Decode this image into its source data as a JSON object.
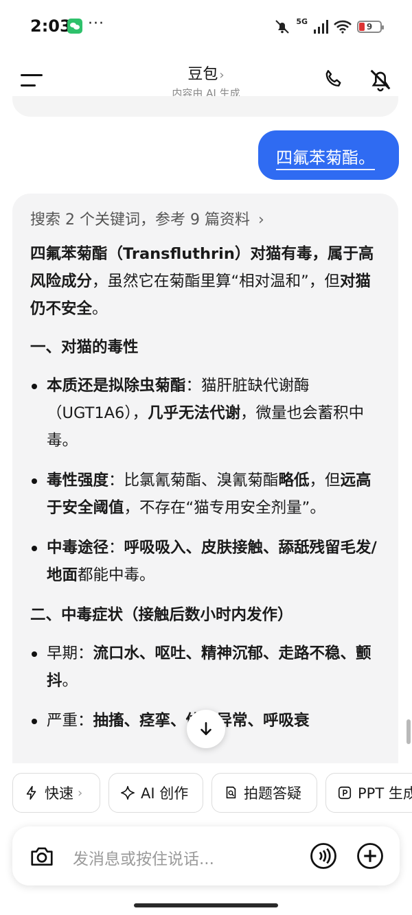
{
  "status_bar": {
    "time": "2:03",
    "more": "···",
    "network": "5G",
    "battery": "9"
  },
  "header": {
    "title": "豆包",
    "title_chevron": "›",
    "subtitle": "内容由 AI 生成"
  },
  "user_message": "四氟苯菊酯。",
  "ai_reply": {
    "reference_line": "搜索 2 个关键词，参考 9 篇资料",
    "reference_chevron": "›",
    "intro": {
      "p1_bold": "四氟苯菊酯（Transfluthrin）对猫有毒，属于高风险成分",
      "p1_text_a": "，虽然它在菊酯里算“相对温和”，但",
      "p1_bold_b": "对猫仍不安全",
      "p1_text_b": "。"
    },
    "section1": {
      "heading": "一、对猫的毒性",
      "items": [
        {
          "bold": "本质还是拟除虫菊酯",
          "text_a": "：猫肝脏缺代谢酶（UGT1A6），",
          "bold_b": "几乎无法代谢",
          "text_b": "，微量也会蓄积中毒。"
        },
        {
          "bold": "毒性强度",
          "text_a": "：比氯氰菊酯、溴氰菊酯",
          "bold_b": "略低",
          "text_b": "，但",
          "bold_c": "远高于安全阈值",
          "text_c": "，不存在“猫专用安全剂量”。"
        },
        {
          "bold": "中毒途径",
          "text_a": "：",
          "bold_b": "呼吸吸入、皮肤接触、舔舐残留毛发/地面",
          "text_b": "都能中毒。"
        }
      ]
    },
    "section2": {
      "heading": "二、中毒症状（接触后数小时内发作）",
      "items": [
        {
          "text_a": "早期：",
          "bold": "流口水、呕吐、精神沉郁、走路不稳、颤抖",
          "text_b": "。"
        },
        {
          "text_a": "严重：",
          "bold": "抽搐、痉挛、体温异常、呼吸衰",
          "text_b": ""
        }
      ]
    }
  },
  "chips": [
    {
      "label": "快速",
      "icon": "lightning-icon",
      "chevron": "›"
    },
    {
      "label": "AI 创作",
      "icon": "sparkle-icon"
    },
    {
      "label": "拍题答疑",
      "icon": "search-doc-icon"
    },
    {
      "label": "PPT 生成",
      "icon": "ppt-icon"
    }
  ],
  "input": {
    "placeholder": "发消息或按住说话..."
  }
}
